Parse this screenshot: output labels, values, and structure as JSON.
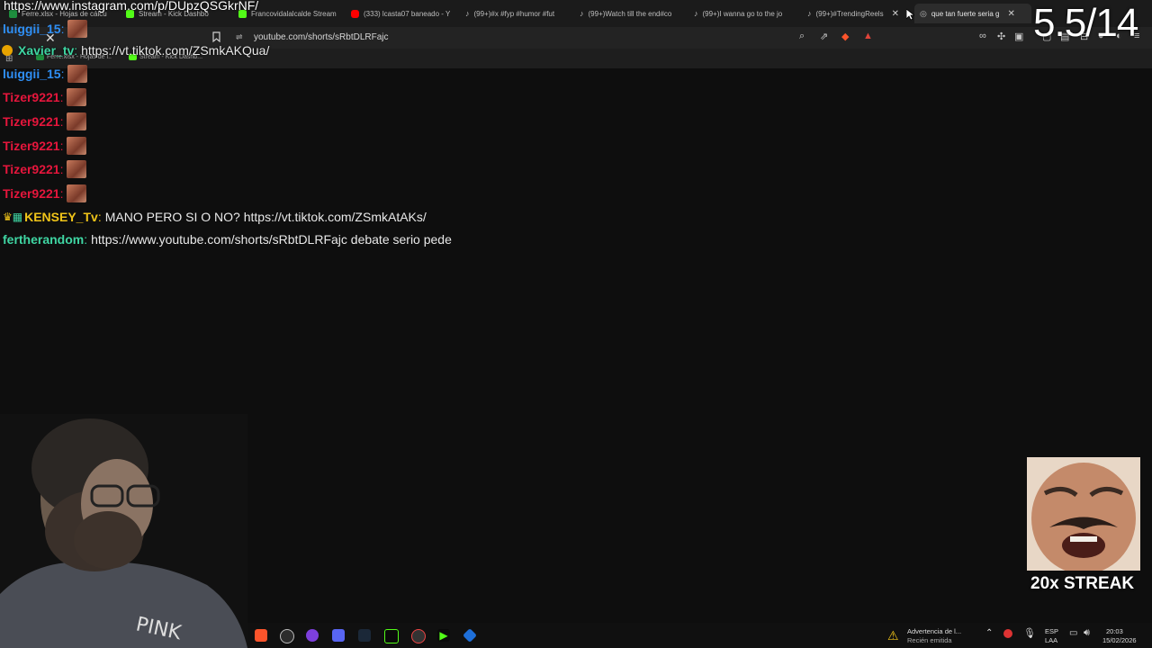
{
  "browser": {
    "tabs": [
      {
        "title": "Ferre.xlsx - Hojas de cálcu",
        "icon_color": "#1e8e3e"
      },
      {
        "title": "Stream - Kick Dashbo",
        "icon_color": "#53fc18"
      },
      {
        "title": "Francovidalalcalde Stream",
        "icon_color": "#53fc18"
      },
      {
        "title": "(333) lcasta07 baneado - Y",
        "icon_color": "#ff0000"
      },
      {
        "title": "(99+)#x #fyp #humor #fut",
        "icon_color": "#ffffff"
      },
      {
        "title": "(99+)Watch till the end#co",
        "icon_color": "#ffffff"
      },
      {
        "title": "(99+)I wanna go to the jo",
        "icon_color": "#ffffff"
      },
      {
        "title": "(99+)#TrendingReels",
        "icon_color": "#ffffff"
      },
      {
        "title": "que tan fuerte seria g",
        "icon_color": "#bbbbbb",
        "active": true
      }
    ],
    "url": "youtube.com/shorts/sRbtDLRFajc",
    "bookmarks": [
      "Ferre.xlsx - Hojas de l..",
      "Stream - Kick Dashb..."
    ]
  },
  "overlay": {
    "instagram_url": "https://www.instagram.com/p/DUpzQSGkrNF/",
    "counter": "5.5/14",
    "xavier_user": "Xavier_tv",
    "xavier_msg": "https://vt.tiktok.com/ZSmkAKQua/"
  },
  "chat": [
    {
      "user": "luiggii_15",
      "color": "#2f8ff5",
      "msg": "",
      "emote": true
    },
    {
      "user": "Tizer9221",
      "color": "#e5163c",
      "msg": "",
      "emote": true
    },
    {
      "user": "Tizer9221",
      "color": "#e5163c",
      "msg": "",
      "emote": true
    },
    {
      "user": "Tizer9221",
      "color": "#e5163c",
      "msg": "",
      "emote": true
    },
    {
      "user": "Tizer9221",
      "color": "#e5163c",
      "msg": "",
      "emote": true
    },
    {
      "user": "Tizer9221",
      "color": "#e5163c",
      "msg": "",
      "emote": true
    },
    {
      "user": "KENSEY_Tv",
      "color": "#f0c419",
      "msg": "MANO PERO SI O NO? https://vt.tiktok.com/ZSmkAtAKs/",
      "emote": false,
      "badges": true
    },
    {
      "user": "fertherandom",
      "color": "#3fd6a3",
      "msg": "https://www.youtube.com/shorts/sRbtDLRFajc debate serio pede",
      "emote": false
    }
  ],
  "top_chat": {
    "user": "luiggii_15",
    "color": "#2f8ff5"
  },
  "streak": {
    "label": "20x STREAK"
  },
  "taskbar": {
    "notice_title": "Advertencia de l...",
    "notice_sub": "Recién emitida",
    "lang": "ESP",
    "lang_sub": "LAA",
    "time": "20:03",
    "date": "15/02/2026"
  }
}
